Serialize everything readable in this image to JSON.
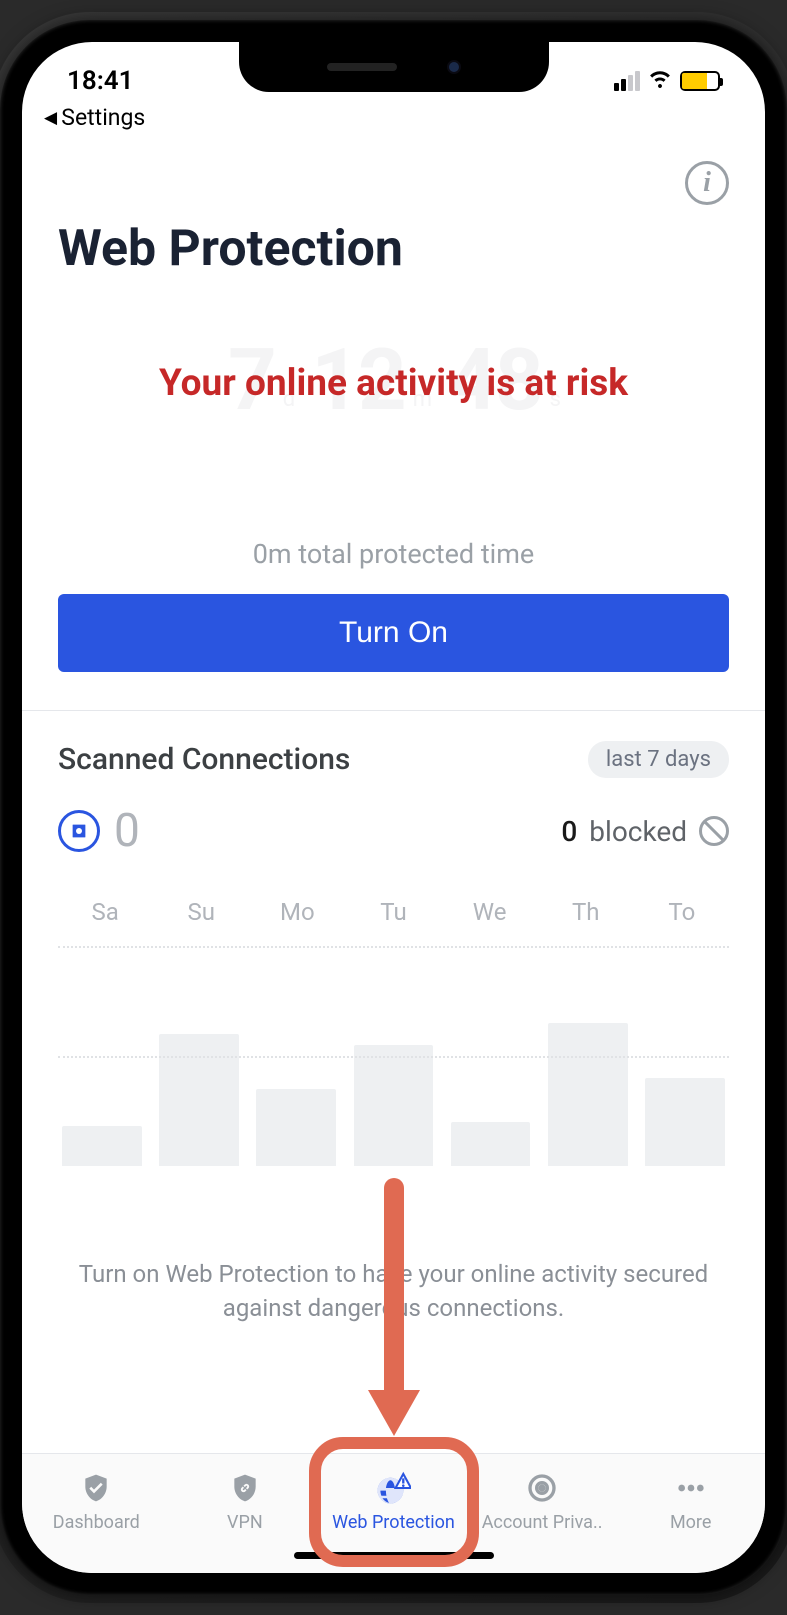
{
  "status_bar": {
    "time": "18:41",
    "back_label": "Settings"
  },
  "header": {
    "title": "Web Protection"
  },
  "risk": {
    "ghost": {
      "d": "7",
      "m": "12",
      "s": "48"
    },
    "message": "Your online activity is at risk",
    "protected_time": "0m total protected time",
    "button_label": "Turn On"
  },
  "scanned": {
    "title": "Scanned Connections",
    "chip": "last 7 days",
    "scanned_count": "0",
    "blocked_count": "0",
    "blocked_label": "blocked"
  },
  "chart_data": {
    "type": "bar",
    "categories": [
      "Sa",
      "Su",
      "Mo",
      "Tu",
      "We",
      "Th",
      "To"
    ],
    "values": [
      18,
      60,
      35,
      55,
      20,
      65,
      40
    ],
    "title": "",
    "xlabel": "",
    "ylabel": "",
    "ylim": [
      0,
      100
    ]
  },
  "hint": "Turn on Web Protection to have your online activity secured against dangerous connections.",
  "tabs": [
    {
      "label": "Dashboard"
    },
    {
      "label": "VPN"
    },
    {
      "label": "Web Protection"
    },
    {
      "label": "Account Priva.."
    },
    {
      "label": "More"
    }
  ]
}
